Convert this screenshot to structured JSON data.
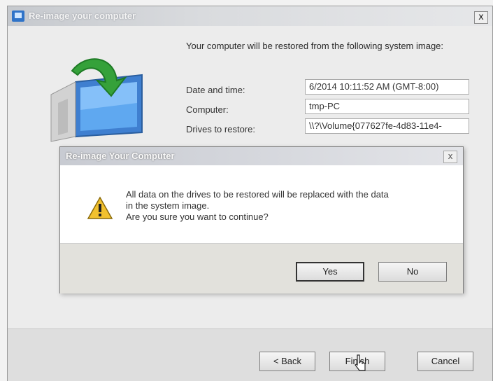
{
  "window": {
    "title": "Re-image your computer",
    "close_glyph": "x"
  },
  "main": {
    "intro_text": "Your computer will be restored from the following system image:",
    "rows": [
      {
        "label": "Date and time:",
        "value": "6/2014 10:11:52 AM (GMT-8:00)"
      },
      {
        "label": "Computer:",
        "value": "tmp-PC"
      },
      {
        "label": "Drives to restore:",
        "value": "\\\\?\\Volume{077627fe-4d83-11e4-"
      }
    ]
  },
  "dialog": {
    "title": "Re-image Your Computer",
    "close_glyph": "x",
    "message_lines": [
      "All data on the drives to be restored will be replaced with the data",
      "in the system image.",
      "Are you sure you want to continue?"
    ],
    "yes_label": "Yes",
    "no_label": "No"
  },
  "footer": {
    "back_label": "< Back",
    "finish_label": "Finish",
    "cancel_label": "Cancel"
  },
  "icons": [
    "restore-computer-icon",
    "warning-icon",
    "app-icon",
    "mouse-cursor-icon"
  ],
  "colors": {
    "title_gradient_start": "#c6c9ce",
    "accent_blue": "#2f73c8",
    "warning_yellow": "#f2c12e",
    "arrow_green": "#35a13a"
  }
}
